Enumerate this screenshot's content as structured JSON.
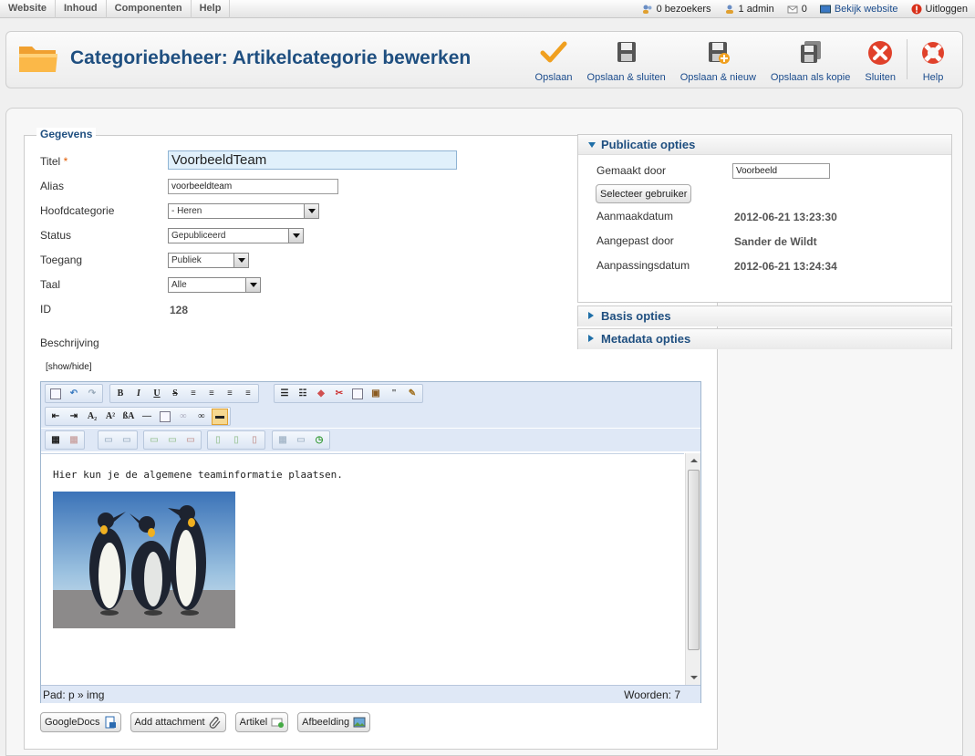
{
  "topmenu": {
    "items": [
      "Website",
      "Inhoud",
      "Componenten",
      "Help"
    ],
    "visitors": "0 bezoekers",
    "admins": "1 admin",
    "messages": "0",
    "view_site": "Bekijk website",
    "logout": "Uitloggen"
  },
  "toolbar": {
    "title": "Categoriebeheer: Artikelcategorie bewerken",
    "save": "Opslaan",
    "save_close": "Opslaan & sluiten",
    "save_new": "Opslaan & nieuw",
    "save_copy": "Opslaan als kopie",
    "close": "Sluiten",
    "help": "Help"
  },
  "form": {
    "legend": "Gegevens",
    "title_label": "Titel",
    "required_mark": "*",
    "title_value": "VoorbeeldTeam",
    "alias_label": "Alias",
    "alias_value": "voorbeeldteam",
    "parent_label": "Hoofdcategorie",
    "parent_value": "- Heren",
    "status_label": "Status",
    "status_value": "Gepubliceerd",
    "access_label": "Toegang",
    "access_value": "Publiek",
    "language_label": "Taal",
    "language_value": "Alle",
    "id_label": "ID",
    "id_value": "128",
    "description_label": "Beschrijving",
    "show_hide": "[show/hide]"
  },
  "editor": {
    "content_text": "Hier kun je de algemene teaminformatie plaatsen.",
    "path": "Pad: p » img",
    "word_count": "Woorden: 7",
    "image_name": "penguins"
  },
  "editor_buttons": {
    "googledocs": "GoogleDocs",
    "attachment": "Add attachment",
    "article": "Artikel",
    "image": "Afbeelding"
  },
  "publish_options": {
    "header": "Publicatie opties",
    "created_by_label": "Gemaakt door",
    "created_by_value": "Voorbeeld",
    "select_user": "Selecteer gebruiker",
    "created_date_label": "Aanmaakdatum",
    "created_date_value": "2012-06-21 13:23:30",
    "modified_by_label": "Aangepast door",
    "modified_by_value": "Sander de Wildt",
    "modified_date_label": "Aanpassingsdatum",
    "modified_date_value": "2012-06-21 13:24:34"
  },
  "basic_options": {
    "header": "Basis opties"
  },
  "metadata_options": {
    "header": "Metadata opties"
  },
  "colors": {
    "title_blue": "#1f4f80",
    "save_orange": "#f0a020",
    "close_red": "#e0412b"
  }
}
